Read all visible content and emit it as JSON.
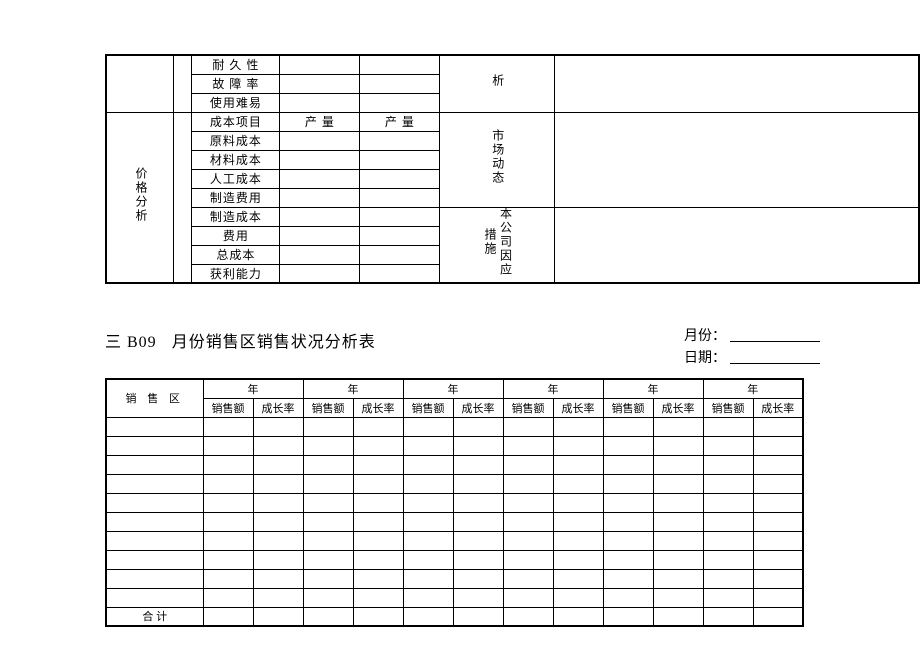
{
  "table1": {
    "top_rows": [
      {
        "label": "耐 久 性"
      },
      {
        "label": "故 障 率"
      },
      {
        "label": "使用难易"
      }
    ],
    "mid_header_xi": "析",
    "price_section_label": "价格分析",
    "mid_label_market": "市场动态",
    "mid_label_company": "本公司因应措施",
    "cost_header": {
      "item": "成本项目",
      "qty1": "产  量",
      "qty2": "产  量"
    },
    "cost_rows": [
      "原料成本",
      "材料成本",
      "人工成本",
      "制造费用",
      "制造成本",
      "费用",
      "总成本",
      "获利能力"
    ]
  },
  "title": {
    "prefix": "三 B09",
    "main": "月份销售区销售状况分析表",
    "month_label": "月份：",
    "date_label": "日期："
  },
  "table2": {
    "region_header": "销 售 区",
    "year_header": "年",
    "sales_label": "销售额",
    "growth_label": "成长率",
    "total_label": "合    计"
  }
}
